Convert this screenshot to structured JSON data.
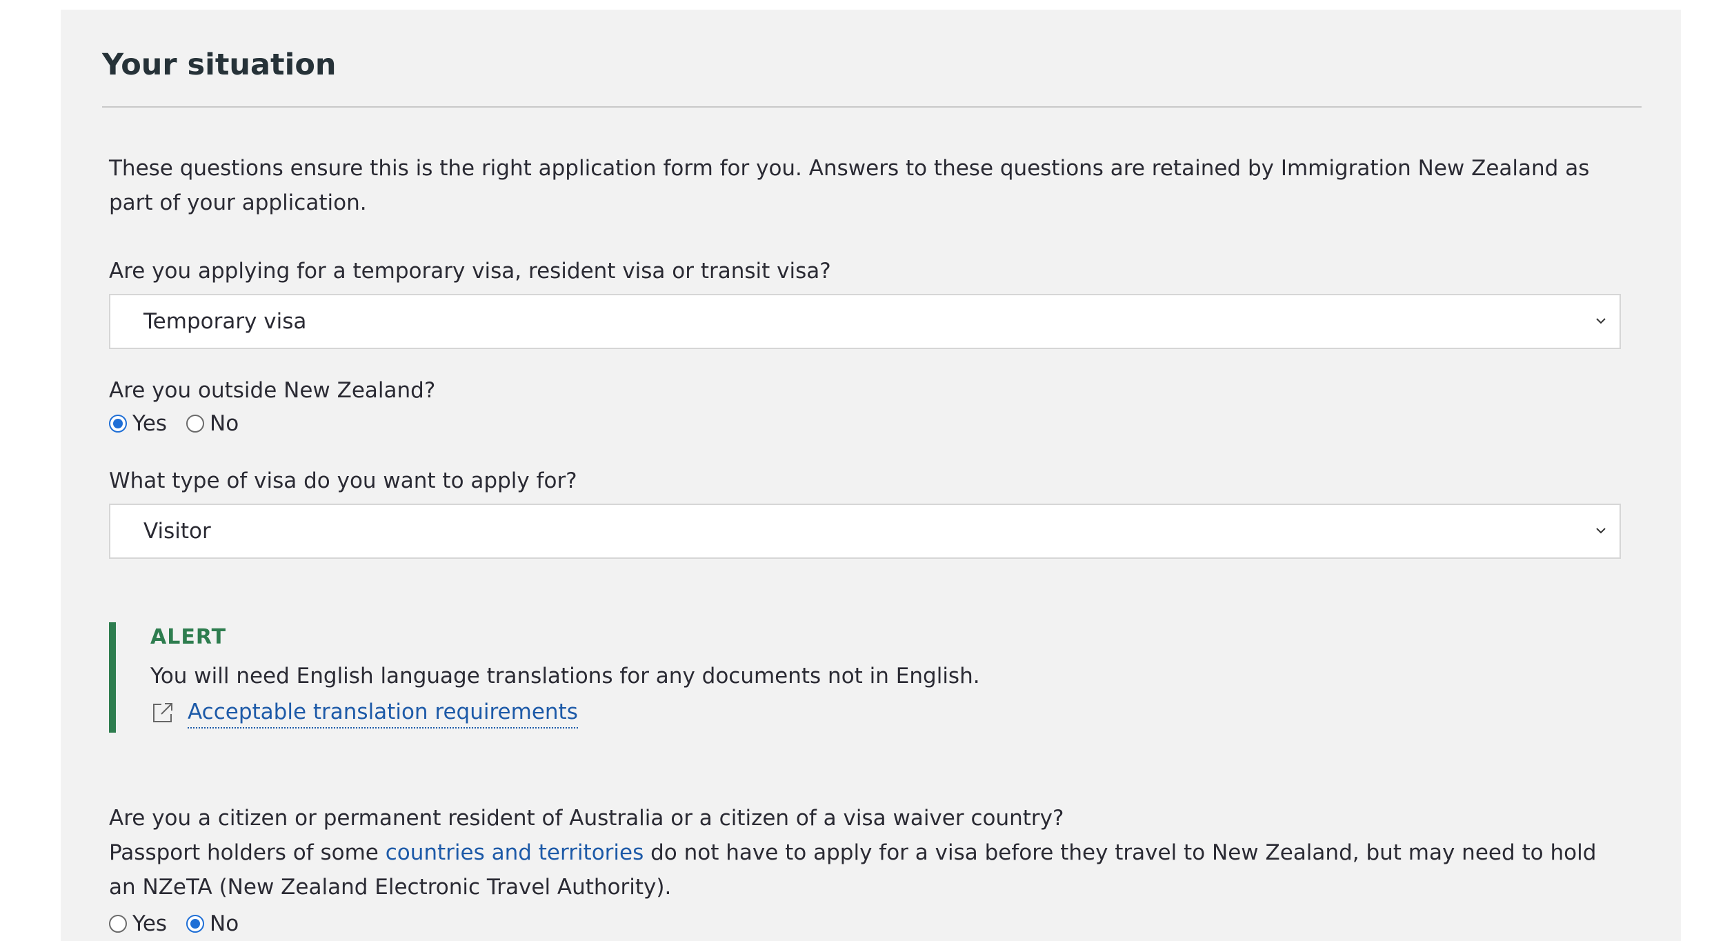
{
  "section": {
    "title": "Your situation"
  },
  "intro": "These questions ensure this is the right application form for you. Answers to these questions are retained by Immigration New Zealand as part of your application.",
  "questions": {
    "visa_category": {
      "label": "Are you applying for a temporary visa, resident visa or transit visa?",
      "selected": "Temporary visa"
    },
    "outside_nz": {
      "label": "Are you outside New Zealand?",
      "options": [
        "Yes",
        "No"
      ],
      "selected": "Yes"
    },
    "visa_type": {
      "label": "What type of visa do you want to apply for?",
      "selected": "Visitor"
    },
    "visa_waiver": {
      "label": "Are you a citizen or permanent resident of Australia or a citizen of a visa waiver country?",
      "help_before_link": "Passport holders of some ",
      "help_link": "countries and territories",
      "help_after_link": " do not have to apply for a visa before they travel to New Zealand, but may need to hold an NZeTA (New Zealand Electronic Travel Authority).",
      "options": [
        "Yes",
        "No"
      ],
      "selected": "No"
    }
  },
  "alert": {
    "title": "ALERT",
    "body": "You will need English language translations for any documents not in English.",
    "link_label": "Acceptable translation requirements",
    "link_icon": "external-link-icon",
    "accent_color": "#2e7d4f"
  },
  "colors": {
    "panel_background": "#f2f2f2",
    "link": "#1d5aa8",
    "radio_selected": "#1f6fd6"
  }
}
